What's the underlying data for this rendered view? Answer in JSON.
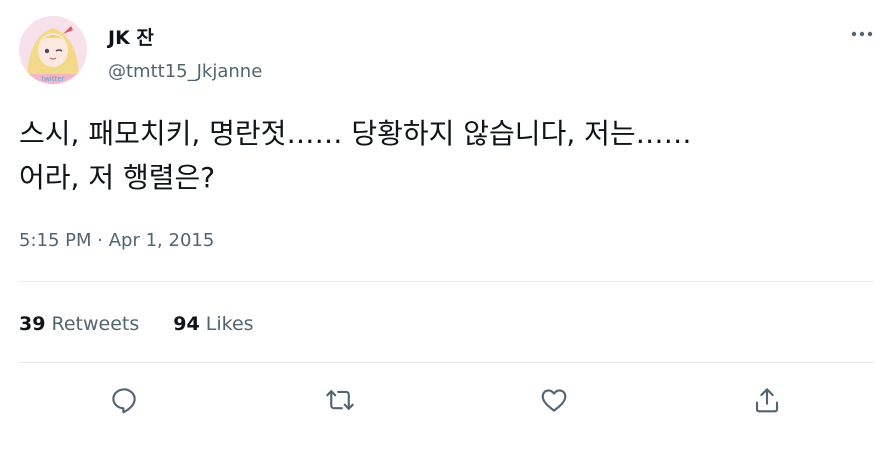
{
  "author": {
    "display_name": "JK 잔",
    "handle": "@tmtt15_Jkjanne",
    "avatar_label": "avatar"
  },
  "tweet": {
    "lines": [
      "스시, 패모치키, 명란젓…… 당황하지 않습니다, 저는……",
      "어라, 저 행렬은?"
    ],
    "time": "5:15 PM",
    "separator": "·",
    "date": "Apr 1, 2015"
  },
  "stats": {
    "retweets_count": "39",
    "retweets_label": "Retweets",
    "likes_count": "94",
    "likes_label": "Likes"
  },
  "icons": {
    "more": "more-horizontal-icon",
    "reply": "reply-icon",
    "retweet": "retweet-icon",
    "like": "heart-icon",
    "share": "share-icon"
  },
  "colors": {
    "text": "#0f1419",
    "secondary": "#536471",
    "divider": "#e6ecf0"
  }
}
